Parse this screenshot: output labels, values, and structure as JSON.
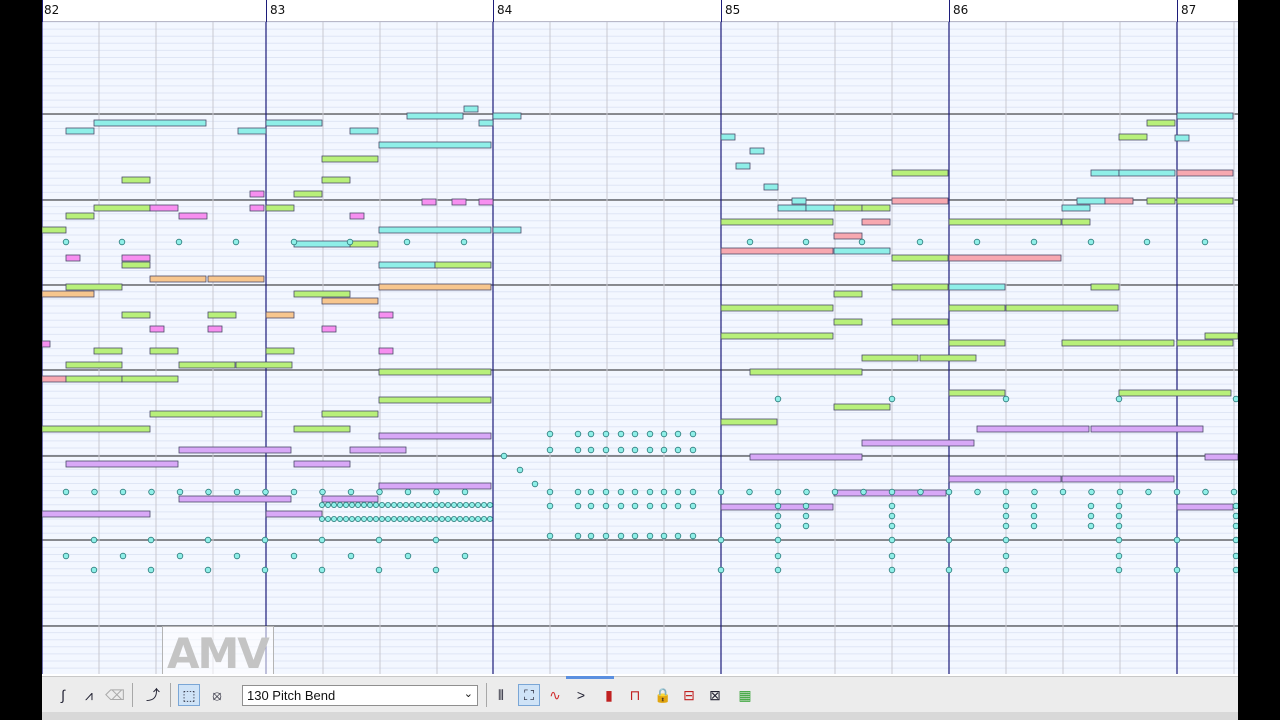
{
  "ruler": {
    "measures": [
      "82",
      "83",
      "84",
      "85",
      "86",
      "87"
    ]
  },
  "watermark": {
    "text": "AMV"
  },
  "toolbar": {
    "cc_select_value": "130 Pitch Bend",
    "tools_left": [
      {
        "name": "curve-tool-icon",
        "glyph": "∫"
      },
      {
        "name": "velocity-tool-icon",
        "glyph": "⩘"
      },
      {
        "name": "eraser-tool-icon",
        "glyph": "⌫"
      },
      {
        "name": "pitch-tool-icon",
        "glyph": "⤴"
      },
      {
        "name": "select-tool-icon",
        "glyph": "⬚"
      },
      {
        "name": "paint-tool-icon",
        "glyph": "⦻"
      }
    ],
    "tools_right": [
      {
        "name": "split-tool-icon",
        "glyph": "⫴"
      },
      {
        "name": "stamp-tool-icon",
        "glyph": "⛶"
      },
      {
        "name": "wave-tool-icon",
        "glyph": "∿"
      },
      {
        "name": "greater-tool-icon",
        "glyph": ">"
      },
      {
        "name": "meter-tool-icon",
        "glyph": "▮"
      },
      {
        "name": "bracket-tool-icon",
        "glyph": "⊓"
      },
      {
        "name": "lock-icon",
        "glyph": "🔒"
      },
      {
        "name": "equalize-tool-icon",
        "glyph": "⊟"
      },
      {
        "name": "scale-tool-icon",
        "glyph": "⊠"
      },
      {
        "name": "random-tool-icon",
        "glyph": "⍁"
      },
      {
        "name": "level-meter-icon",
        "glyph": "▦"
      }
    ]
  },
  "colors": {
    "cyan": "#8fefe8",
    "green": "#b8f07a",
    "pink": "#f7a8b0",
    "orange": "#f7c68e",
    "magenta": "#f78ff0",
    "purple": "#d8a8f7",
    "measure_line": "#1c1c7a",
    "octave_line": "#222222"
  }
}
